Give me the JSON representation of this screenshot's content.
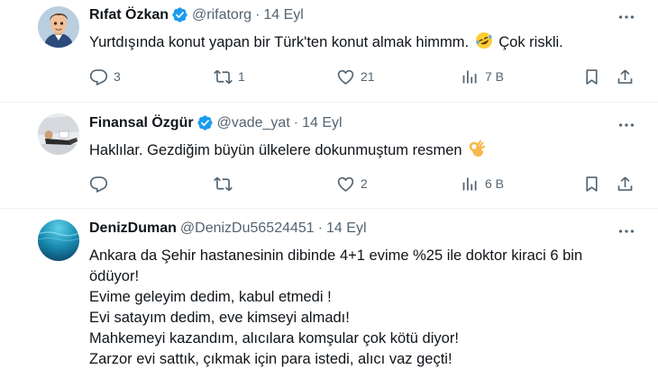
{
  "tweets": [
    {
      "name": "Rıfat Özkan",
      "handle": "@rifatorg",
      "separator": "·",
      "date": "14 Eyl",
      "text_before_emoji": "Yurtdışında konut yapan bir Türk'ten konut almak himmm.",
      "emoji": "rolling-on-floor-laughing",
      "text_after_emoji": "Çok riskli.",
      "replies": "3",
      "reposts": "1",
      "likes": "21",
      "views": "7 B"
    },
    {
      "name": "Finansal Özgür",
      "handle": "@vade_yat",
      "separator": "·",
      "date": "14 Eyl",
      "text_before_emoji": "Haklılar. Gezdiğim büyün ülkelere dokunmuştum resmen",
      "emoji": "ok-hand",
      "text_after_emoji": "",
      "replies": "",
      "reposts": "",
      "likes": "2",
      "views": "6 B"
    },
    {
      "name": "DenizDuman",
      "handle": "@DenizDu56524451",
      "separator": "·",
      "date": "14 Eyl",
      "lines": [
        "Ankara da Şehir hastanesinin dibinde 4+1 evime %25 ile doktor kiraci 6 bin",
        "ödüyor!",
        "Evime geleyim dedim, kabul etmedi !",
        "Evi satayım dedim, eve kimseyi almadı!",
        "Mahkemeyi kazandım, alıcılara komşular çok kötü diyor!",
        "Zarzor evi sattık, çıkmak için para istedi, alıcı vaz geçti!"
      ]
    }
  ],
  "icons": {
    "verified": "verified-badge-icon",
    "more": "more-dots-icon",
    "reply": "reply-icon",
    "repost": "repost-icon",
    "like": "heart-icon",
    "views": "views-icon",
    "bookmark": "bookmark-icon",
    "share": "share-icon"
  },
  "colors": {
    "verified_blue": "#1d9bf0",
    "text_primary": "#0f1419",
    "text_secondary": "#536471",
    "divider": "#eff3f4"
  }
}
